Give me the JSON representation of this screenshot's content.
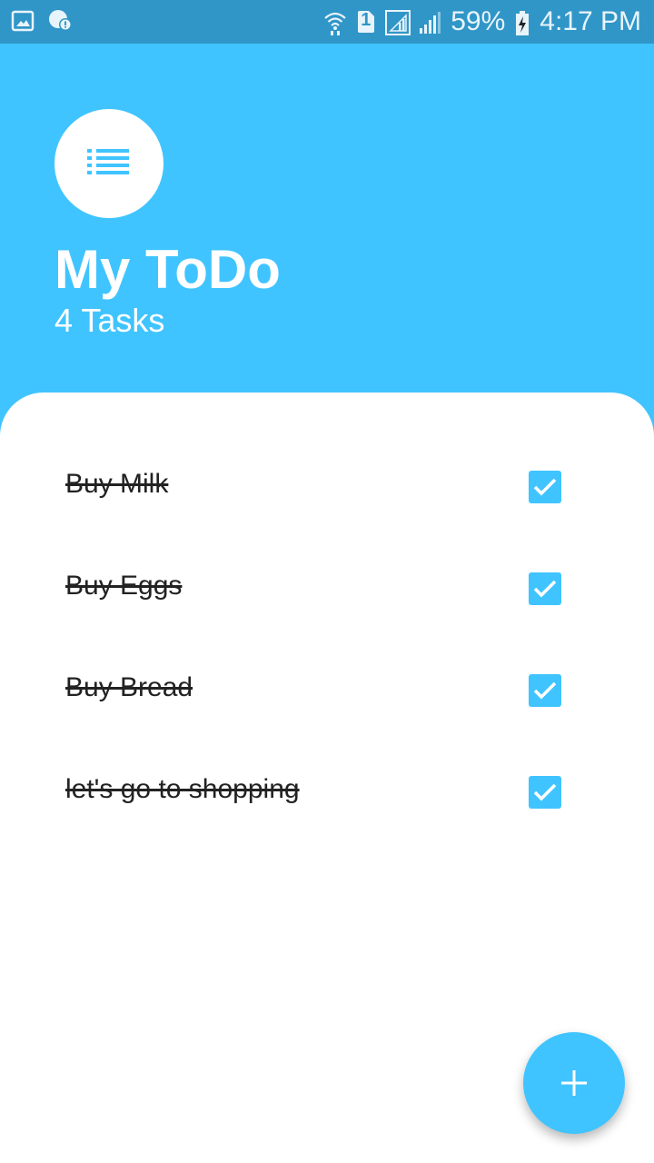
{
  "status_bar": {
    "battery": "59%",
    "time": "4:17 PM",
    "sim_slot": "1",
    "icons": [
      "gallery-icon",
      "chat-alert-icon",
      "wifi-icon",
      "sim-icon",
      "signal-icon",
      "signal-icon",
      "battery-charging-icon"
    ]
  },
  "header": {
    "title": "My ToDo",
    "task_count": "4 Tasks",
    "logo_icon": "list-icon"
  },
  "tasks": [
    {
      "label": "Buy Milk",
      "done": true
    },
    {
      "label": "Buy Eggs",
      "done": true
    },
    {
      "label": "Buy Bread",
      "done": true
    },
    {
      "label": "let's go to shopping",
      "done": true
    }
  ],
  "fab": {
    "icon": "plus-icon"
  },
  "colors": {
    "accent": "#40c4ff",
    "status_bar": "#3096c8",
    "card": "#ffffff",
    "text": "#222222"
  }
}
